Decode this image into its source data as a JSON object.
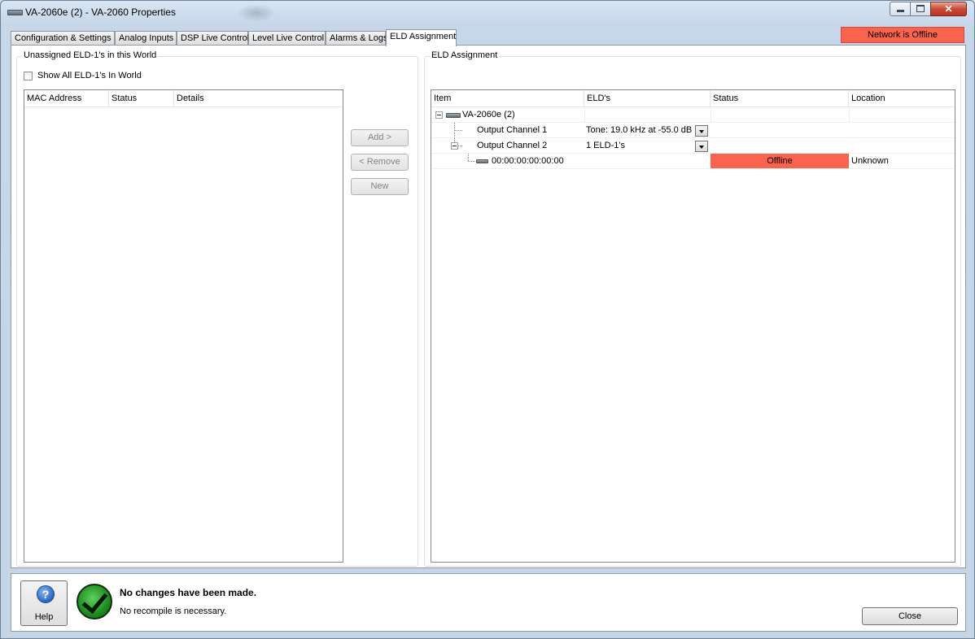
{
  "window": {
    "title": "VA-2060e (2) - VA-2060 Properties"
  },
  "tabs": [
    {
      "label": "Configuration & Settings"
    },
    {
      "label": "Analog Inputs"
    },
    {
      "label": "DSP Live Control"
    },
    {
      "label": "Level Live Control"
    },
    {
      "label": "Alarms & Logs"
    },
    {
      "label": "ELD Assignment",
      "active": true
    }
  ],
  "network_status": {
    "label": "Network is Offline",
    "color": "#fa634d"
  },
  "unassigned": {
    "group_title": "Unassigned ELD-1's in this World",
    "show_all_label": "Show All ELD-1's In World",
    "show_all_checked": false,
    "columns": [
      "MAC Address",
      "Status",
      "Details"
    ],
    "rows": []
  },
  "actions": {
    "add_label": "Add >",
    "remove_label": "< Remove",
    "new_label": "New"
  },
  "assignment": {
    "group_title": "ELD Assignment",
    "columns": [
      "Item",
      "ELD's",
      "Status",
      "Location"
    ],
    "tree": {
      "device": "VA-2060e (2)",
      "channel1": {
        "item": "Output Channel 1",
        "elds": "Tone: 19.0 kHz at -55.0 dB"
      },
      "channel2": {
        "item": "Output Channel 2",
        "elds": "1 ELD-1's"
      },
      "eld": {
        "item": "00:00:00:00:00:00",
        "status": "Offline",
        "location": "Unknown"
      }
    }
  },
  "footer": {
    "help_label": "Help",
    "message_title": "No changes have been made.",
    "message_sub": "No recompile is necessary.",
    "close_label": "Close"
  }
}
